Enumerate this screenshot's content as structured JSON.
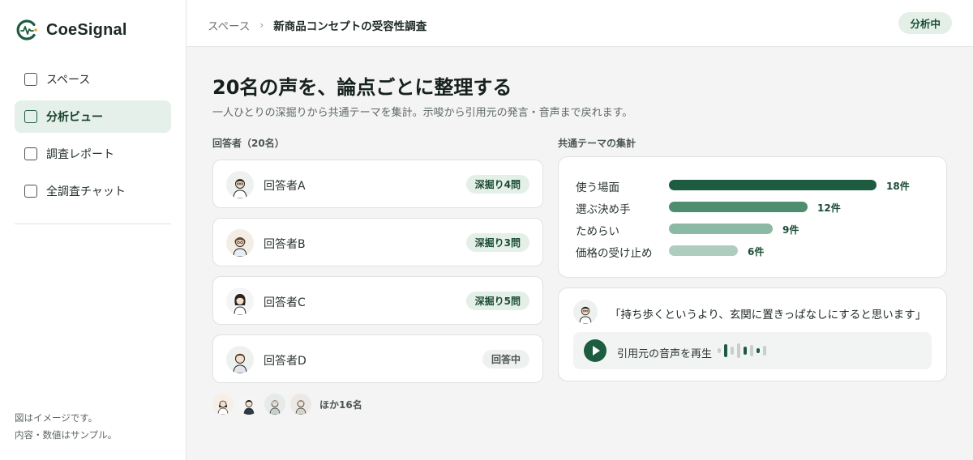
{
  "app": {
    "name": "CoeSignal"
  },
  "sidebar": {
    "items": [
      {
        "label": "スペース",
        "active": false
      },
      {
        "label": "分析ビュー",
        "active": true
      },
      {
        "label": "調査レポート",
        "active": false
      },
      {
        "label": "全調査チャット",
        "active": false
      }
    ],
    "note_line1": "図はイメージです。",
    "note_line2": "内容・数値はサンプル。"
  },
  "header": {
    "breadcrumb_parent": "スペース",
    "breadcrumb_separator": "›",
    "breadcrumb_current": "新商品コンセプトの受容性調査",
    "status": "分析中"
  },
  "main": {
    "title": "20名の声を、論点ごとに整理する",
    "subtitle": "一人ひとりの深掘りから共通テーマを集計。示唆から引用元の発言・音声まで戻れます。",
    "respondents_label": "回答者（20名）",
    "respondents": [
      {
        "name": "回答者A",
        "status": "深掘り4問",
        "kind": "deep"
      },
      {
        "name": "回答者B",
        "status": "深掘り3問",
        "kind": "deep"
      },
      {
        "name": "回答者C",
        "status": "深掘り5問",
        "kind": "deep"
      },
      {
        "name": "回答者D",
        "status": "回答中",
        "kind": "wip"
      }
    ],
    "more_label": "ほか16名",
    "themes_label": "共通テーマの集計",
    "themes": [
      {
        "label": "使う場面",
        "count": 18,
        "count_label": "18件",
        "color": "#1d5c40"
      },
      {
        "label": "選ぶ決め手",
        "count": 12,
        "count_label": "12件",
        "color": "#4e8d70"
      },
      {
        "label": "ためらい",
        "count": 9,
        "count_label": "9件",
        "color": "#8cb9a4"
      },
      {
        "label": "価格の受け止め",
        "count": 6,
        "count_label": "6件",
        "color": "#afcdbf"
      }
    ],
    "quote": {
      "text": "「持ち歩くというより、玄関に置きっぱなしにすると思います」",
      "audio_label": "引用元の音声を再生"
    }
  },
  "colors": {
    "accent": "#1d5c40",
    "accent_light": "#e4efe8",
    "background": "#f3f4f3"
  }
}
